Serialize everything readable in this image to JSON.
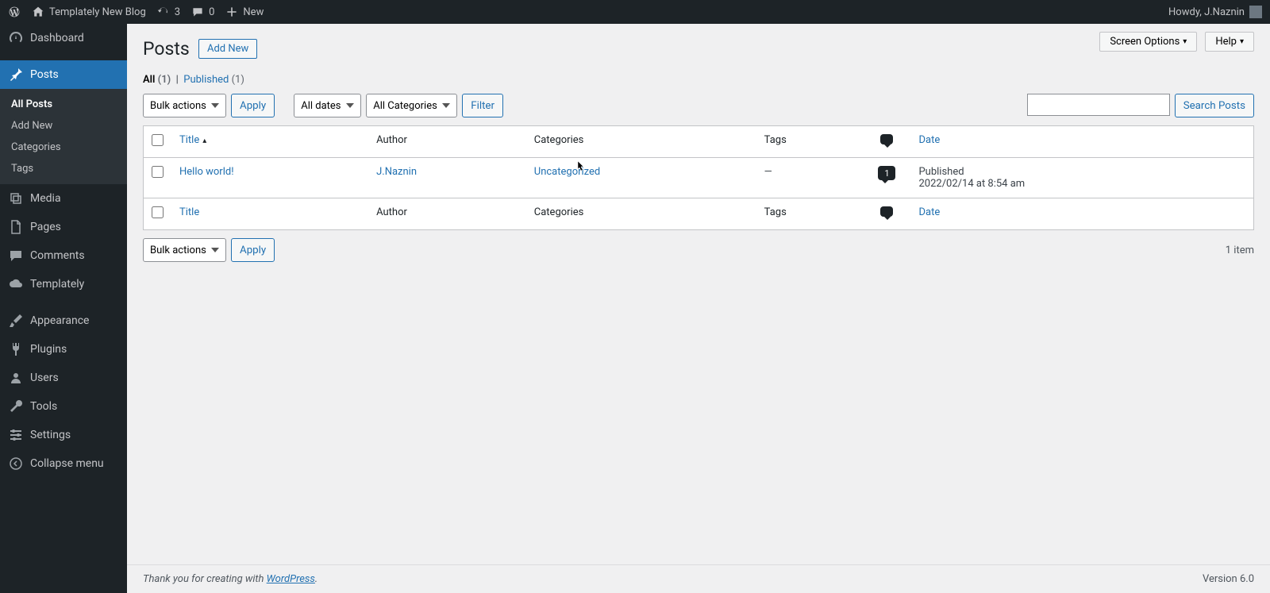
{
  "adminbar": {
    "site_name": "Templately New Blog",
    "updates": "3",
    "comments": "0",
    "new": "New",
    "howdy": "Howdy, J.Naznin"
  },
  "sidebar": {
    "dashboard": "Dashboard",
    "posts": "Posts",
    "posts_sub": {
      "all": "All Posts",
      "add": "Add New",
      "cats": "Categories",
      "tags": "Tags"
    },
    "media": "Media",
    "pages": "Pages",
    "comments": "Comments",
    "templately": "Templately",
    "appearance": "Appearance",
    "plugins": "Plugins",
    "users": "Users",
    "tools": "Tools",
    "settings": "Settings",
    "collapse": "Collapse menu"
  },
  "topbuttons": {
    "screen": "Screen Options",
    "help": "Help"
  },
  "page": {
    "title": "Posts",
    "addnew": "Add New",
    "filter_all": "All",
    "filter_all_cnt": "(1)",
    "filter_pub": "Published",
    "filter_pub_cnt": "(1)",
    "search_btn": "Search Posts",
    "bulk": "Bulk actions",
    "apply": "Apply",
    "alldates": "All dates",
    "allcats": "All Categories",
    "filterbtn": "Filter",
    "itemcount": "1 item"
  },
  "table": {
    "cols": {
      "title": "Title",
      "author": "Author",
      "cats": "Categories",
      "tags": "Tags",
      "date": "Date"
    },
    "row": {
      "title": "Hello world!",
      "author": "J.Naznin",
      "cat": "Uncategorized",
      "tags": "—",
      "comments": "1",
      "status": "Published",
      "datetime": "2022/02/14 at 8:54 am"
    }
  },
  "footer": {
    "thanks_pre": "Thank you for creating with ",
    "wp": "WordPress",
    "version": "Version 6.0"
  }
}
